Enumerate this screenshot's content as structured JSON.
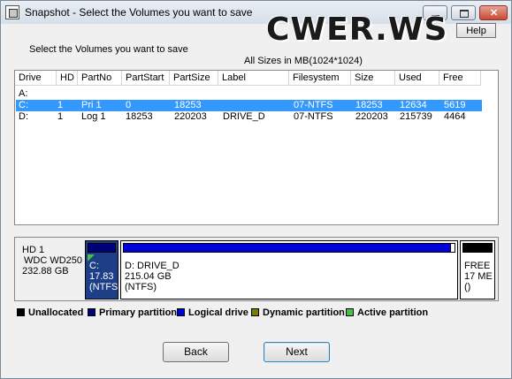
{
  "window": {
    "title": "Snapshot - Select the Volumes you want to save"
  },
  "help_label": "Help",
  "watermark_text": "CWER.WS",
  "prompt": "Select the Volumes you want to save",
  "sizes_note": "All Sizes in MB(1024*1024)",
  "columns": [
    "Drive",
    "HD",
    "PartNo",
    "PartStart",
    "PartSize",
    "Label",
    "Filesystem",
    "Size",
    "Used",
    "Free"
  ],
  "rows": [
    {
      "drive": "A:",
      "hd": "",
      "partno": "",
      "partstart": "",
      "partsize": "",
      "label": "",
      "filesystem": "",
      "size": "",
      "used": "",
      "free": "",
      "selected": false
    },
    {
      "drive": "C:",
      "hd": "1",
      "partno": "Pri  1",
      "partstart": "0",
      "partsize": "18253",
      "label": "",
      "filesystem": "07-NTFS",
      "size": "18253",
      "used": "12634",
      "free": "5619",
      "selected": true
    },
    {
      "drive": "D:",
      "hd": "1",
      "partno": "Log  1",
      "partstart": "18253",
      "partsize": "220203",
      "label": "DRIVE_D",
      "filesystem": "07-NTFS",
      "size": "220203",
      "used": "215739",
      "free": "4464",
      "selected": false
    }
  ],
  "disk": {
    "name": "HD 1",
    "model": "WDC WD250",
    "capacity": "232.88 GB",
    "partitions": {
      "c": {
        "line1": "C:",
        "line2": "17.83",
        "line3": "(NTFS"
      },
      "d": {
        "line1": "D: DRIVE_D",
        "line2": "215.04 GB",
        "line3": "(NTFS)"
      },
      "free": {
        "line1": "FREE",
        "line2": "17 ME",
        "line3": "()"
      }
    }
  },
  "legend": [
    {
      "label": "Unallocated",
      "color": "#000000"
    },
    {
      "label": "Primary partition",
      "color": "#00007b"
    },
    {
      "label": "Logical drive",
      "color": "#0000d8"
    },
    {
      "label": "Dynamic partition",
      "color": "#7b7b00"
    },
    {
      "label": "Active partition",
      "color": "#49c049"
    }
  ],
  "buttons": {
    "back": "Back",
    "next": "Next"
  }
}
